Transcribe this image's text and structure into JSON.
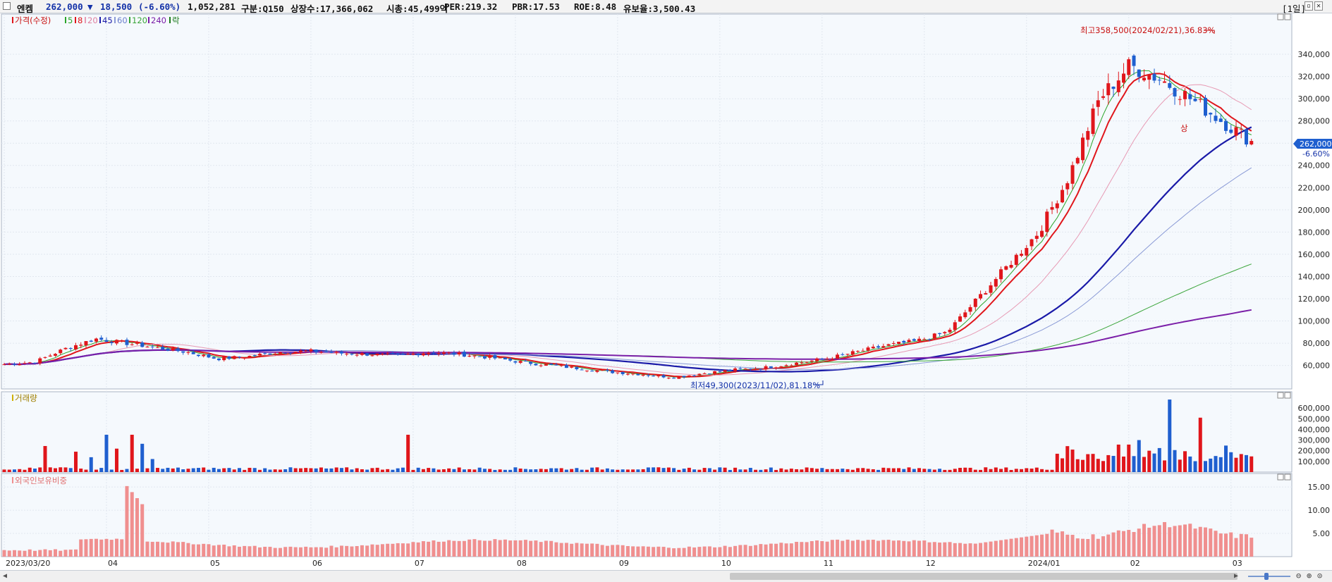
{
  "header": {
    "name": "엔켐",
    "price": "262,000",
    "change_arrow": "▼",
    "change": "18,500",
    "change_pct": "(-6.60%)",
    "volume": "1,052,281",
    "market": "구분:Q150",
    "shares": "상장수:17,366,062",
    "mktcap": "시총:45,499억",
    "per": "PER:219.32",
    "pbr": "PBR:17.53",
    "roe": "ROE:8.48",
    "reserve": "유보율:3,500.43",
    "period": "[1일]"
  },
  "legend": {
    "price_label": "가격(수정)",
    "ma_labels": [
      "5",
      "8",
      "20",
      "45",
      "60",
      "120",
      "240"
    ],
    "event_label": "락",
    "volume_label": "거래량",
    "foreign_label": "외국인보유비중"
  },
  "annotations": {
    "high": "최고358,500(2024/02/21),36.83%",
    "low": "최저49,300(2023/11/02),81.18%",
    "upper_limit": "상",
    "current_price": "262,000",
    "current_pct": "-6.60%"
  },
  "colors": {
    "up": "#e0161b",
    "down": "#1f5fcf",
    "ma5": "#2aa52a",
    "ma8": "#e0161b",
    "ma20": "#e79ab4",
    "ma45": "#1a1aa8",
    "ma60": "#8a9ad6",
    "ma120": "#3aa53a",
    "ma240": "#7b1fa8",
    "foreign": "#f08f8f",
    "background": "#f5f9fd"
  },
  "chart_data": [
    {
      "type": "candlestick",
      "x_ticks": [
        "2023/03/20",
        "04",
        "05",
        "06",
        "07",
        "08",
        "09",
        "10",
        "11",
        "12",
        "2024/01",
        "02",
        "03"
      ],
      "y_ticks": [
        "60,000",
        "80,000",
        "100,000",
        "120,000",
        "140,000",
        "160,000",
        "180,000",
        "200,000",
        "220,000",
        "240,000",
        "260,000",
        "280,000",
        "300,000",
        "320,000",
        "340,000"
      ],
      "ylim": [
        42000,
        373000
      ],
      "close_series": [
        61000,
        63000,
        75000,
        84000,
        80000,
        76000,
        72000,
        66000,
        68000,
        72000,
        73000,
        71000,
        70000,
        69000,
        72000,
        70000,
        67000,
        63000,
        60000,
        57000,
        54000,
        52000,
        49300,
        53000,
        56000,
        58000,
        62000,
        66000,
        72000,
        78000,
        82000,
        90000,
        120000,
        150000,
        180000,
        230000,
        300000,
        330000,
        318000,
        300000,
        280500,
        262000
      ],
      "high": {
        "value": 358500,
        "date": "2024/02/21"
      },
      "low": {
        "value": 49300,
        "date": "2023/11/02"
      },
      "last": {
        "value": 262000,
        "change": -18500,
        "change_pct": -6.6
      }
    },
    {
      "type": "bar",
      "title": "거래량",
      "y_ticks": [
        "100,000",
        "200,000",
        "300,000",
        "400,000",
        "500,000",
        "600,000"
      ],
      "ylim": [
        0,
        700000
      ],
      "peaks": [
        {
          "month": "2024/02",
          "value": 680000
        },
        {
          "month": "2024/02",
          "value": 510000
        },
        {
          "month": "2024/01",
          "value": 300000
        },
        {
          "month": "2023/04",
          "value": 350000
        }
      ]
    },
    {
      "type": "bar",
      "title": "외국인보유비중",
      "y_ticks": [
        "5.00",
        "10.00",
        "15.00"
      ],
      "ylim": [
        0,
        17
      ],
      "peaks": [
        {
          "month": "2023/04",
          "value": 15.2
        },
        {
          "month": "2024/02",
          "value": 7.9
        },
        {
          "month": "2024/03",
          "value": 6.0
        }
      ]
    }
  ]
}
